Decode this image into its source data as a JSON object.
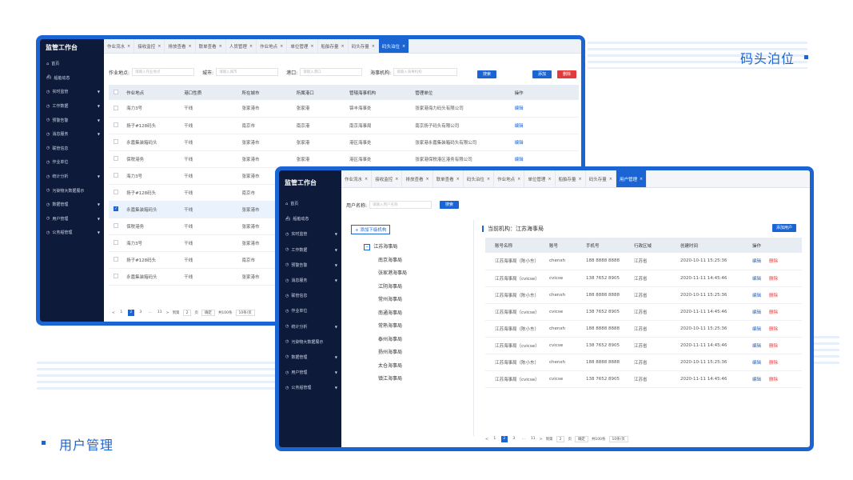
{
  "captions": {
    "top": "码头泊位",
    "bottom": "用户管理"
  },
  "colors": {
    "accent": "#1a64d4",
    "sidebar": "#0e1a3a",
    "danger": "#e23b3b"
  },
  "sidebar": {
    "brand": "监管工作台",
    "items": [
      {
        "label": "首页",
        "icon": "home-icon",
        "arrow": false
      },
      {
        "label": "船舶动态",
        "icon": "ship-icon",
        "arrow": false
      },
      {
        "label": "实时监管",
        "icon": "clock-icon",
        "arrow": true
      },
      {
        "label": "工作数据",
        "icon": "clock-icon",
        "arrow": true
      },
      {
        "label": "预警告警",
        "icon": "clock-icon",
        "arrow": true
      },
      {
        "label": "消息服务",
        "icon": "clock-icon",
        "arrow": true
      },
      {
        "label": "联管信息",
        "icon": "clock-icon",
        "arrow": false
      },
      {
        "label": "作业单位",
        "icon": "clock-icon",
        "arrow": false
      },
      {
        "label": "统计分析",
        "icon": "clock-icon",
        "arrow": true
      },
      {
        "label": "污染物大数据展示",
        "icon": "clock-icon",
        "arrow": false
      },
      {
        "label": "数据管理",
        "icon": "clock-icon",
        "arrow": true
      },
      {
        "label": "用户管理",
        "icon": "clock-icon",
        "arrow": true
      },
      {
        "label": "公务船管理",
        "icon": "clock-icon",
        "arrow": true
      }
    ]
  },
  "win1": {
    "tabs": [
      {
        "label": "作业流水",
        "active": false
      },
      {
        "label": "接收监控",
        "active": false
      },
      {
        "label": "排放查看",
        "active": false
      },
      {
        "label": "联单查看",
        "active": false
      },
      {
        "label": "人员管理",
        "active": false
      },
      {
        "label": "作业地点",
        "active": false
      },
      {
        "label": "单位管理",
        "active": false
      },
      {
        "label": "船舶存量",
        "active": false
      },
      {
        "label": "码头存量",
        "active": false
      },
      {
        "label": "码头泊位",
        "active": true
      }
    ],
    "filters": [
      {
        "label": "作业地点:",
        "placeholder": "请输入作业地点"
      },
      {
        "label": "城市:",
        "placeholder": "请输入城市"
      },
      {
        "label": "港口:",
        "placeholder": "请输入港口"
      },
      {
        "label": "海事机构:",
        "placeholder": "请输入海事机构"
      }
    ],
    "search_label": "搜索",
    "add_label": "添加",
    "delete_label": "删除",
    "columns": [
      "作业地点",
      "港口性质",
      "所在城市",
      "所属港口",
      "管辖海事机构",
      "管理单位",
      "操作"
    ],
    "rows": [
      {
        "checked": false,
        "cells": [
          "海力3号",
          "干线",
          "张家港市",
          "张家港",
          "锦丰海事处",
          "张家港海力码头有限公司",
          "编辑"
        ]
      },
      {
        "checked": false,
        "cells": [
          "扬子#128码头",
          "干线",
          "南京市",
          "南京港",
          "南京海事局",
          "南京扬子码头有限公司",
          "编辑"
        ]
      },
      {
        "checked": false,
        "cells": [
          "永嘉集装箱码头",
          "干线",
          "张家港市",
          "张家港",
          "港区海事处",
          "张家港永嘉集装箱码头有限公司",
          "编辑"
        ]
      },
      {
        "checked": false,
        "cells": [
          "保税港务",
          "干线",
          "张家港市",
          "张家港",
          "港区海事处",
          "张家港保税港区港务有限公司",
          "编辑"
        ]
      },
      {
        "checked": false,
        "cells": [
          "海力3号",
          "干线",
          "张家港市",
          "",
          "",
          "",
          ""
        ]
      },
      {
        "checked": false,
        "cells": [
          "扬子#128码头",
          "干线",
          "南京市",
          "",
          "",
          "",
          ""
        ]
      },
      {
        "checked": true,
        "cells": [
          "永嘉集装箱码头",
          "干线",
          "张家港市",
          "",
          "",
          "",
          ""
        ]
      },
      {
        "checked": false,
        "cells": [
          "保税港务",
          "干线",
          "张家港市",
          "",
          "",
          "",
          ""
        ]
      },
      {
        "checked": false,
        "cells": [
          "海力3号",
          "干线",
          "张家港市",
          "",
          "",
          "",
          ""
        ]
      },
      {
        "checked": false,
        "cells": [
          "扬子#128码头",
          "干线",
          "南京市",
          "",
          "",
          "",
          ""
        ]
      },
      {
        "checked": false,
        "cells": [
          "永嘉集装箱码头",
          "干线",
          "张家港市",
          "",
          "",
          "",
          ""
        ]
      }
    ],
    "pager": {
      "prev": "<",
      "pages": [
        "1",
        "2",
        "3",
        "...",
        "11"
      ],
      "next": ">",
      "goto": "到第",
      "page_input": "2",
      "page_unit": "页",
      "confirm": "确定",
      "total": "共100条",
      "size": "10条/页"
    }
  },
  "win2": {
    "tabs": [
      {
        "label": "作业流水",
        "active": false
      },
      {
        "label": "接收监控",
        "active": false
      },
      {
        "label": "排放查看",
        "active": false
      },
      {
        "label": "联单查看",
        "active": false
      },
      {
        "label": "码头泊位",
        "active": false
      },
      {
        "label": "作业地点",
        "active": false
      },
      {
        "label": "单位管理",
        "active": false
      },
      {
        "label": "船舶存量",
        "active": false
      },
      {
        "label": "码头存量",
        "active": false
      },
      {
        "label": "用户管理",
        "active": true
      }
    ],
    "filter": {
      "label": "用户名称:",
      "placeholder": "请输入用户名称"
    },
    "search_label": "搜索",
    "add_org_label": "+ 添加下级机构",
    "tree": {
      "root": "江苏海事局",
      "children": [
        "南京海事局",
        "张家港海事局",
        "江阴海事局",
        "常州海事局",
        "南通海事局",
        "常熟海事局",
        "泰州海事局",
        "扬州海事局",
        "太仓海事局",
        "镇江海事局"
      ]
    },
    "current_org": "当前机构：江苏海事局",
    "add_user_label": "添加用户",
    "columns": [
      "账号名称",
      "账号",
      "手机号",
      "行政区域",
      "创建时间",
      "操作"
    ],
    "rows": [
      [
        "江苏海事局（陈小东）",
        "chenxh",
        "188 8888 8888",
        "江苏省",
        "2020-10-11  15:25:36"
      ],
      [
        "江苏海事局（cvicse）",
        "cvicse",
        "138 7652 8905",
        "江苏省",
        "2020-11-11  14:45:46"
      ],
      [
        "江苏海事局（陈小东）",
        "chenxh",
        "188 8888 8888",
        "江苏省",
        "2020-10-11  15:25:36"
      ],
      [
        "江苏海事局（cvicse）",
        "cvicse",
        "138 7652 8905",
        "江苏省",
        "2020-11-11  14:45:46"
      ],
      [
        "江苏海事局（陈小东）",
        "chenxh",
        "188 8888 8888",
        "江苏省",
        "2020-10-11  15:25:36"
      ],
      [
        "江苏海事局（cvicse）",
        "cvicse",
        "138 7652 8905",
        "江苏省",
        "2020-11-11  14:45:46"
      ],
      [
        "江苏海事局（陈小东）",
        "chenxh",
        "188 8888 8888",
        "江苏省",
        "2020-10-11  15:25:36"
      ],
      [
        "江苏海事局（cvicse）",
        "cvicse",
        "138 7652 8905",
        "江苏省",
        "2020-11-11  14:45:46"
      ]
    ],
    "edit_label": "编辑",
    "delete_label": "删除",
    "pager": {
      "prev": "<",
      "pages": [
        "1",
        "2",
        "3",
        "...",
        "11"
      ],
      "next": ">",
      "goto": "到第",
      "page_input": "2",
      "page_unit": "页",
      "confirm": "确定",
      "total": "共100条",
      "size": "10条/页"
    }
  }
}
